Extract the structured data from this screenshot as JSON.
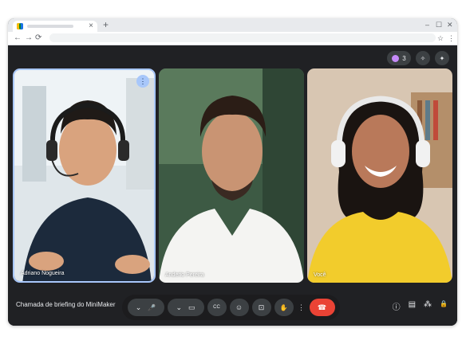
{
  "browser": {
    "new_tab_glyph": "+",
    "tab_close_glyph": "×",
    "window_controls": {
      "minimize": "–",
      "maximize": "☐",
      "close": "✕"
    },
    "nav": {
      "back": "←",
      "forward": "→",
      "reload": "⟳"
    },
    "toolbar_icons": {
      "star": "☆",
      "menu": "⋮"
    }
  },
  "meet": {
    "top_right": {
      "people_count": "3",
      "glyph_sparkle": "✦",
      "glyph_effects": "✧"
    },
    "participants": [
      {
        "name": "Adriano Nogueira"
      },
      {
        "name": "Anderio Pereira"
      },
      {
        "name": "Você"
      }
    ],
    "tile_menu_glyph": "⋮",
    "meeting_title": "Chamada de briefing do MiniMaker",
    "controls": {
      "audio_options_glyph": "⌄",
      "mic_glyph": "🎤",
      "video_options_glyph": "⌄",
      "camera_glyph": "▭",
      "captions_glyph": "CC",
      "emoji_glyph": "☺",
      "present_glyph": "⊡",
      "raise_hand_glyph": "✋",
      "more_glyph": "⋮",
      "end_call_glyph": "☎"
    },
    "right_controls": {
      "info_glyph": "ⓘ",
      "chat_glyph": "▤",
      "activities_glyph": "⁂",
      "host_controls_glyph": "🔒"
    },
    "colors": {
      "background": "#202124",
      "control": "#3c4043",
      "end_call": "#ea4335",
      "active_border": "#a8c7fa"
    }
  }
}
